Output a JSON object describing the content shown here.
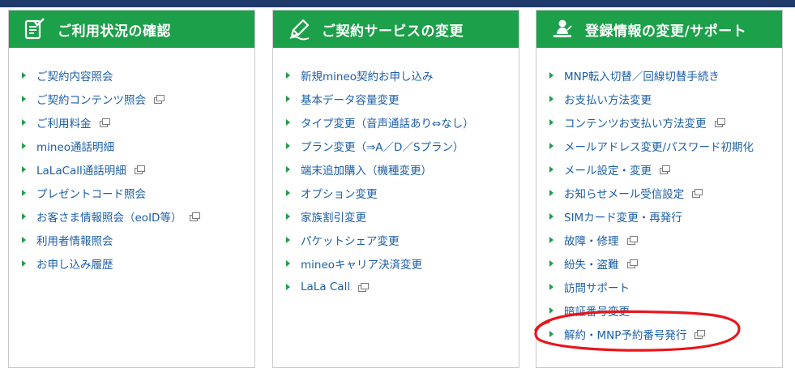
{
  "panels": [
    {
      "id": "usage",
      "title": "ご利用状況の確認",
      "icon": "checklist-icon",
      "items": [
        {
          "label": "ご契約内容照会",
          "ext": false
        },
        {
          "label": "ご契約コンテンツ照会",
          "ext": true
        },
        {
          "label": "ご利用料金",
          "ext": true
        },
        {
          "label": "mineo通話明細",
          "ext": false
        },
        {
          "label": "LaLaCall通話明細",
          "ext": true
        },
        {
          "label": "プレゼントコード照会",
          "ext": false
        },
        {
          "label": "お客さま情報照会（eoID等）",
          "ext": true
        },
        {
          "label": "利用者情報照会",
          "ext": false
        },
        {
          "label": "お申し込み履歴",
          "ext": false
        }
      ]
    },
    {
      "id": "service",
      "title": "ご契約サービスの変更",
      "icon": "pencil-edit-icon",
      "items": [
        {
          "label": "新規mineo契約お申し込み",
          "ext": false
        },
        {
          "label": "基本データ容量変更",
          "ext": false
        },
        {
          "label": "タイプ変更（音声通話あり⇔なし）",
          "ext": false
        },
        {
          "label": "プラン変更（⇒A／D／Sプラン）",
          "ext": false
        },
        {
          "label": "端末追加購入（機種変更）",
          "ext": false
        },
        {
          "label": "オプション変更",
          "ext": false
        },
        {
          "label": "家族割引変更",
          "ext": false
        },
        {
          "label": "パケットシェア変更",
          "ext": false
        },
        {
          "label": "mineoキャリア決済変更",
          "ext": false
        },
        {
          "label": "LaLa Call",
          "ext": true
        }
      ]
    },
    {
      "id": "registration",
      "title": "登録情報の変更/サポート",
      "icon": "support-person-icon",
      "items": [
        {
          "label": "MNP転入切替／回線切替手続き",
          "ext": false
        },
        {
          "label": "お支払い方法変更",
          "ext": false
        },
        {
          "label": "コンテンツお支払い方法変更",
          "ext": true
        },
        {
          "label": "メールアドレス変更/パスワード初期化",
          "ext": false
        },
        {
          "label": "メール設定・変更",
          "ext": true
        },
        {
          "label": "お知らせメール受信設定",
          "ext": true
        },
        {
          "label": "SIMカード変更・再発行",
          "ext": false
        },
        {
          "label": "故障・修理",
          "ext": true
        },
        {
          "label": "紛失・盗難",
          "ext": true
        },
        {
          "label": "訪問サポート",
          "ext": false
        },
        {
          "label": "暗証番号変更",
          "ext": false
        },
        {
          "label": "解約・MNP予約番号発行",
          "ext": true
        }
      ]
    }
  ],
  "colors": {
    "header": "#1da04a",
    "link": "#1c5fa8",
    "topbar": "#1f3a6b",
    "annotation": "#e8151b"
  }
}
